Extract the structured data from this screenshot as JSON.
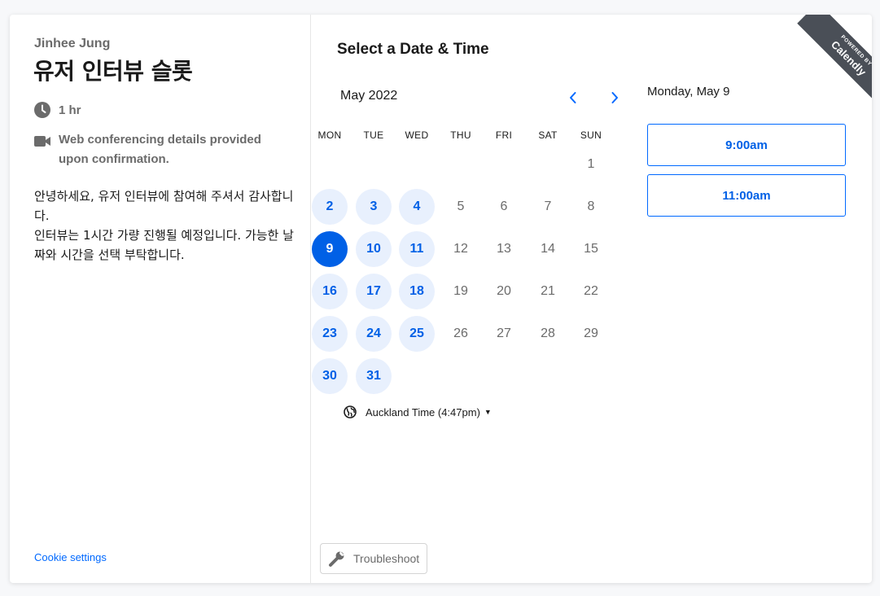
{
  "host_name": "Jinhee Jung",
  "event_title": "유저 인터뷰 슬롯",
  "duration": "1 hr",
  "location_note": "Web conferencing details provided upon confirmation.",
  "description": [
    "안녕하세요, 유저 인터뷰에 참여해 주셔서 감사합니다.",
    "인터뷰는 1시간 가량 진행될 예정입니다. 가능한 날짜와 시간을 선택 부탁합니다."
  ],
  "cookie_settings": "Cookie settings",
  "picker_title": "Select a Date & Time",
  "month_label": "May 2022",
  "weekdays": [
    "MON",
    "TUE",
    "WED",
    "THU",
    "FRI",
    "SAT",
    "SUN"
  ],
  "days": [
    {
      "n": "1",
      "state": "none"
    },
    {
      "n": "2",
      "state": "available"
    },
    {
      "n": "3",
      "state": "available"
    },
    {
      "n": "4",
      "state": "available"
    },
    {
      "n": "5",
      "state": "none"
    },
    {
      "n": "6",
      "state": "none"
    },
    {
      "n": "7",
      "state": "none"
    },
    {
      "n": "8",
      "state": "none"
    },
    {
      "n": "9",
      "state": "selected"
    },
    {
      "n": "10",
      "state": "available"
    },
    {
      "n": "11",
      "state": "available"
    },
    {
      "n": "12",
      "state": "none"
    },
    {
      "n": "13",
      "state": "none"
    },
    {
      "n": "14",
      "state": "none"
    },
    {
      "n": "15",
      "state": "none"
    },
    {
      "n": "16",
      "state": "available"
    },
    {
      "n": "17",
      "state": "available"
    },
    {
      "n": "18",
      "state": "available"
    },
    {
      "n": "19",
      "state": "none"
    },
    {
      "n": "20",
      "state": "none"
    },
    {
      "n": "21",
      "state": "none"
    },
    {
      "n": "22",
      "state": "none"
    },
    {
      "n": "23",
      "state": "available"
    },
    {
      "n": "24",
      "state": "available"
    },
    {
      "n": "25",
      "state": "available"
    },
    {
      "n": "26",
      "state": "none"
    },
    {
      "n": "27",
      "state": "none"
    },
    {
      "n": "28",
      "state": "none"
    },
    {
      "n": "29",
      "state": "none"
    },
    {
      "n": "30",
      "state": "available"
    },
    {
      "n": "31",
      "state": "available"
    }
  ],
  "timezone": "Auckland Time (4:47pm)",
  "selected_date": "Monday, May 9",
  "time_slots": [
    "9:00am",
    "11:00am"
  ],
  "troubleshoot": "Troubleshoot",
  "badge": {
    "top": "POWERED BY",
    "brand": "Calendly"
  },
  "colors": {
    "accent": "#0069ff",
    "available_bg": "#e8f0fd",
    "ribbon": "#4a4f57"
  },
  "icons": {
    "duration": "clock-icon",
    "location": "video-camera-icon",
    "timezone": "globe-icon",
    "troubleshoot": "wrench-icon",
    "prev": "chevron-left-icon",
    "next": "chevron-right-icon"
  }
}
